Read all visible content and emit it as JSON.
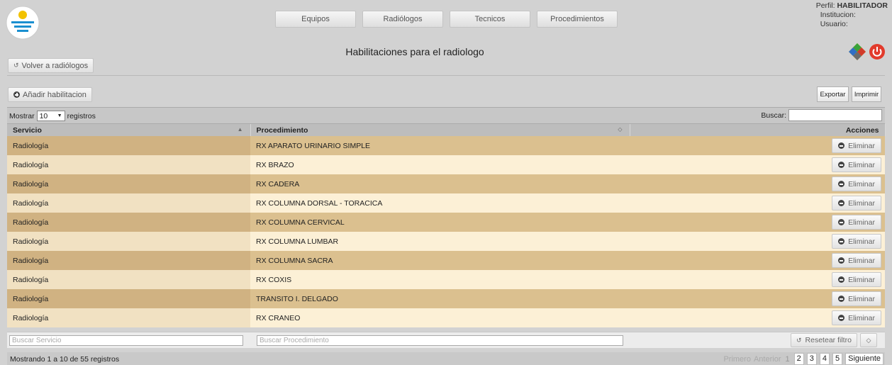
{
  "nav": [
    "Equipos",
    "Radiólogos",
    "Tecnicos",
    "Procedimientos"
  ],
  "profile": {
    "perfil_label": "Perfil:",
    "perfil_value": "HABILITADOR",
    "institucion_label": "Institucion:",
    "usuario_label": "Usuario:"
  },
  "page_title": "Habilitaciones para el radiologo",
  "back_button": "Volver a radiólogos",
  "add_button": "Añadir habilitacion",
  "export_button": "Exportar",
  "print_button": "Imprimir",
  "length": {
    "prefix": "Mostrar",
    "value": "10",
    "suffix": "registros"
  },
  "search_label": "Buscar:",
  "columns": {
    "servicio": "Servicio",
    "procedimiento": "Procedimiento",
    "acciones": "Acciones"
  },
  "rows": [
    {
      "servicio": "Radiología",
      "procedimiento": "RX APARATO URINARIO SIMPLE",
      "action": "Eliminar"
    },
    {
      "servicio": "Radiología",
      "procedimiento": "RX BRAZO",
      "action": "Eliminar"
    },
    {
      "servicio": "Radiología",
      "procedimiento": "RX CADERA",
      "action": "Eliminar"
    },
    {
      "servicio": "Radiología",
      "procedimiento": "RX COLUMNA DORSAL - TORACICA",
      "action": "Eliminar"
    },
    {
      "servicio": "Radiología",
      "procedimiento": "RX COLUMNA CERVICAL",
      "action": "Eliminar"
    },
    {
      "servicio": "Radiología",
      "procedimiento": "RX COLUMNA LUMBAR",
      "action": "Eliminar"
    },
    {
      "servicio": "Radiología",
      "procedimiento": "RX COLUMNA SACRA",
      "action": "Eliminar"
    },
    {
      "servicio": "Radiología",
      "procedimiento": "RX COXIS",
      "action": "Eliminar"
    },
    {
      "servicio": "Radiología",
      "procedimiento": "TRANSITO I. DELGADO",
      "action": "Eliminar"
    },
    {
      "servicio": "Radiología",
      "procedimiento": "RX CRANEO",
      "action": "Eliminar"
    }
  ],
  "filters": {
    "servicio_placeholder": "Buscar Servicio",
    "procedimiento_placeholder": "Buscar Procedimiento",
    "reset_label": "Resetear filtro"
  },
  "info": "Mostrando 1 a 10 de 55 registros",
  "pagination": {
    "first": "Primero",
    "prev": "Anterior",
    "pages": [
      "1",
      "2",
      "3",
      "4",
      "5"
    ],
    "next": "Siguiente"
  }
}
